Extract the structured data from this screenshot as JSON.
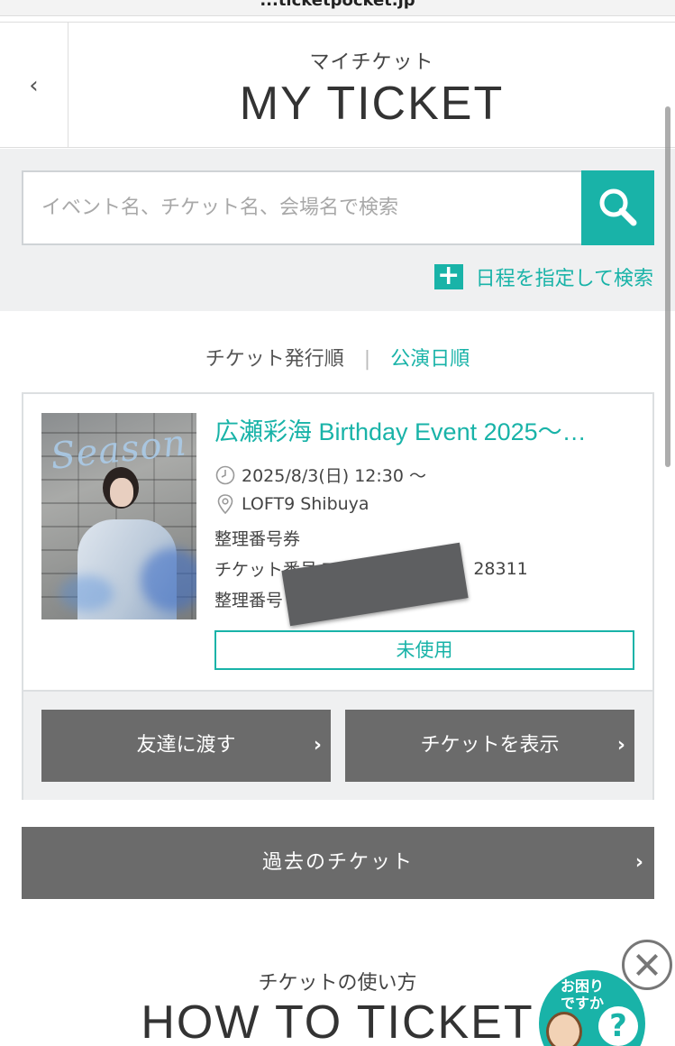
{
  "url_bar": {
    "text": "...ticketpocket.jp"
  },
  "header": {
    "back_label": "‹",
    "subtitle": "マイチケット",
    "title": "MY TICKET"
  },
  "search": {
    "placeholder": "イベント名、チケット名、会場名で検索",
    "value": "",
    "date_search_label": "日程を指定して検索"
  },
  "sort": {
    "issue_order": "チケット発行順",
    "separator": "|",
    "date_order": "公演日順",
    "active": "公演日順"
  },
  "ticket": {
    "title": "広瀬彩海 Birthday Event 2025〜…",
    "datetime": "2025/8/3(日) 12:30 〜",
    "venue": "LOFT9 Shibuya",
    "type": "整理番号券",
    "ticket_number_label": "チケット番号:TGHH",
    "ticket_number_tail": "28311",
    "seq_number_label": "整理番号",
    "status": "未使用",
    "transfer_button": "友達に渡す",
    "show_button": "チケットを表示",
    "image_caption": "Season"
  },
  "past_button": "過去のチケット",
  "howto": {
    "subtitle": "チケットの使い方",
    "title": "HOW TO TICKET"
  },
  "help": {
    "text_line1": "お困り",
    "text_line2": "ですか",
    "mark": "?"
  },
  "colors": {
    "accent": "#19b3a8",
    "button_gray": "#6b6b6b",
    "panel_bg": "#eff0f1",
    "border": "#dcdfe1"
  },
  "icons": [
    "back-chevron-icon",
    "search-icon",
    "plus-icon",
    "clock-icon",
    "location-pin-icon",
    "chevron-right-icon",
    "close-icon",
    "help-character-icon"
  ]
}
